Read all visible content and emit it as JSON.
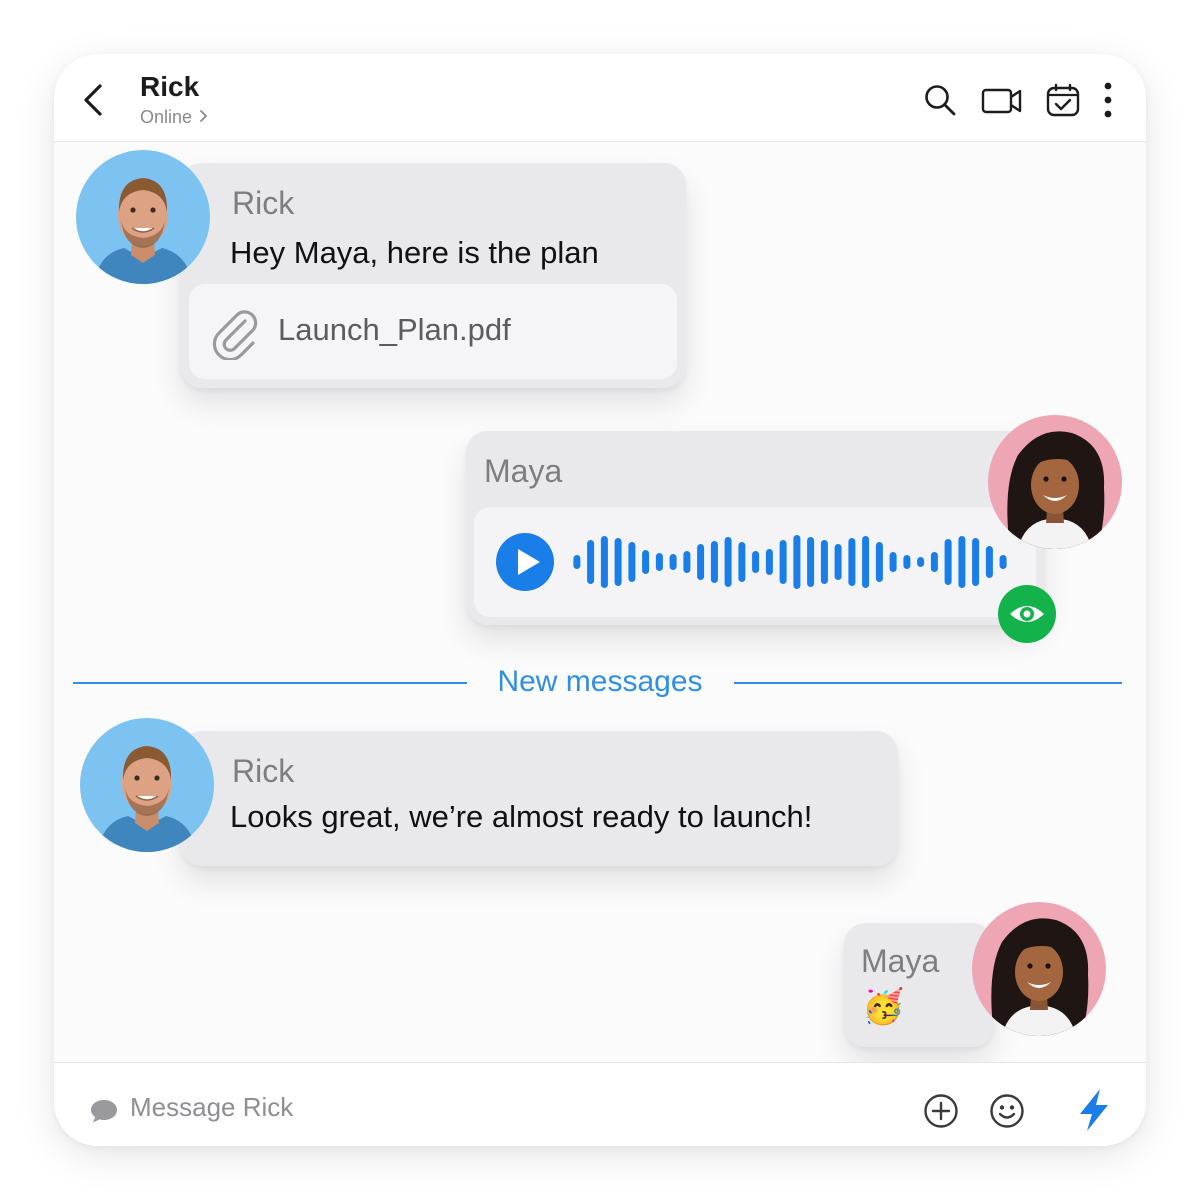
{
  "header": {
    "contact_name": "Rick",
    "status": "Online",
    "icons": [
      "back-arrow-icon",
      "search-icon",
      "video-call-icon",
      "calendar-check-icon",
      "more-vertical-icon"
    ]
  },
  "messages": [
    {
      "sender": "Rick",
      "text": "Hey Maya, here is the plan",
      "attachment": {
        "file_name": "Launch_Plan.pdf",
        "icon": "paperclip-icon"
      }
    },
    {
      "sender": "Maya",
      "type": "voice",
      "icon": "play-icon",
      "status_icon": "eye-icon"
    },
    {
      "sender": "Rick",
      "text": "Looks great, we’re almost ready to launch!"
    },
    {
      "sender": "Maya",
      "text": "🥳"
    }
  ],
  "divider": {
    "label": "New messages"
  },
  "composer": {
    "placeholder": "Message Rick",
    "icons": [
      "chat-bubble-icon",
      "add-icon",
      "emoji-icon",
      "lightning-icon"
    ]
  },
  "colors": {
    "accent": "#2f8fe4",
    "voice_blue": "#1a7ee8",
    "seen_green": "#13b24a",
    "bubble": "#e9e9eb",
    "rick_avatar_bg": "#7cc3f2",
    "maya_avatar_bg": "#eea6b4"
  }
}
